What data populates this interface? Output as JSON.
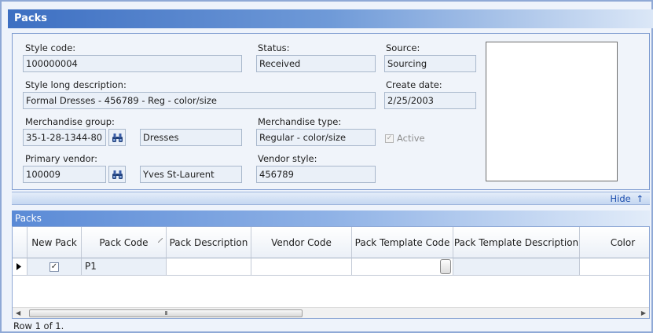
{
  "window": {
    "title": "Packs"
  },
  "details": {
    "style_code": {
      "label": "Style code:",
      "value": "100000004"
    },
    "status": {
      "label": "Status:",
      "value": "Received"
    },
    "source": {
      "label": "Source:",
      "value": "Sourcing"
    },
    "style_long_description": {
      "label": "Style long description:",
      "value": "Formal Dresses - 456789 - Reg - color/size"
    },
    "create_date": {
      "label": "Create date:",
      "value": "2/25/2003"
    },
    "merchandise_group": {
      "label": "Merchandise group:",
      "code": "35-1-28-1344-80",
      "name": "Dresses"
    },
    "merchandise_type": {
      "label": "Merchandise type:",
      "value": "Regular - color/size"
    },
    "active": {
      "label": "Active",
      "checked": true
    },
    "primary_vendor": {
      "label": "Primary vendor:",
      "code": "100009",
      "name": "Yves St-Laurent"
    },
    "vendor_style": {
      "label": "Vendor style:",
      "value": "456789"
    },
    "hide_link": "Hide",
    "hide_arrow": "↑"
  },
  "packs_grid": {
    "title": "Packs",
    "columns": [
      "New Pack",
      "Pack Code",
      "Pack Description",
      "Vendor Code",
      "Pack Template Code",
      "Pack Template Description",
      "Color"
    ],
    "rows": [
      {
        "new_pack": true,
        "pack_code": "P1",
        "pack_description": "",
        "vendor_code": "",
        "pack_template_code": "",
        "pack_template_description": "",
        "color": ""
      }
    ],
    "scroll_grip": "III"
  },
  "status_bar": {
    "text": "Row 1 of 1."
  },
  "icons": {
    "lookup": "binoculars-icon",
    "row_indicator": "triangle-right-icon",
    "sort": "sort-indicator-icon"
  },
  "colors": {
    "title_gradient_start": "#3d6fc2",
    "panel_border": "#7d9bd0",
    "link": "#1e4fae"
  }
}
